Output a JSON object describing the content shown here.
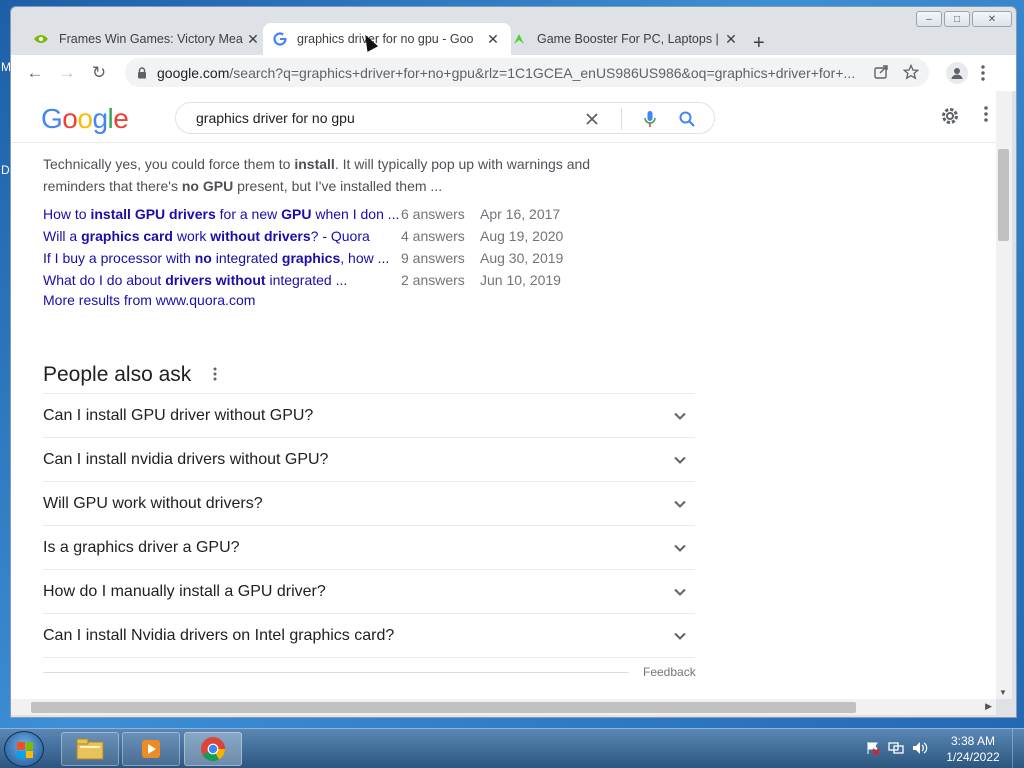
{
  "desktop": {
    "edge_letters": [
      "M",
      "D"
    ]
  },
  "window_controls": {
    "minimize": "‒",
    "maximize": "□",
    "close": "✕"
  },
  "tabs": [
    {
      "title": "Frames Win Games: Victory Mea",
      "favicon": "nvidia-favicon",
      "close": "✕"
    },
    {
      "title": "graphics driver for no gpu - Goo",
      "favicon": "google-favicon",
      "close": "✕"
    },
    {
      "title": "Game Booster For PC, Laptops | F",
      "favicon": "razer-favicon",
      "close": "✕"
    }
  ],
  "new_tab": "+",
  "toolbar": {
    "back": "←",
    "forward": "→",
    "reload": "↻",
    "url_host": "google.com",
    "url_rest": "/search?q=graphics+driver+for+no+gpu&rlz=1C1GCEA_enUS986US986&oq=graphics+driver+for+..."
  },
  "google": {
    "query": "graphics driver for no gpu",
    "logo_letters": [
      {
        "ch": "G",
        "color": "#4285f4"
      },
      {
        "ch": "o",
        "color": "#ea4335"
      },
      {
        "ch": "o",
        "color": "#fbbc05"
      },
      {
        "ch": "g",
        "color": "#4285f4"
      },
      {
        "ch": "l",
        "color": "#34a853"
      },
      {
        "ch": "e",
        "color": "#ea4335"
      }
    ]
  },
  "snippet": {
    "line1_a": "Technically yes, you could force them to ",
    "line1_b": "install",
    "line1_c": ". It will typically pop up with warnings and",
    "line2_a": "reminders that there's ",
    "line2_b": "no GPU",
    "line2_c": " present, but I've installed them ..."
  },
  "sub_results": [
    {
      "parts": [
        [
          "How to ",
          false
        ],
        [
          "install GPU drivers",
          true
        ],
        [
          " for a new ",
          false
        ],
        [
          "GPU",
          true
        ],
        [
          " when I don ...",
          false
        ]
      ],
      "answers": "6 answers",
      "date": "Apr 16, 2017"
    },
    {
      "parts": [
        [
          "Will a ",
          false
        ],
        [
          "graphics card",
          true
        ],
        [
          " work ",
          false
        ],
        [
          "without drivers",
          true
        ],
        [
          "? - Quora",
          false
        ]
      ],
      "answers": "4 answers",
      "date": "Aug 19, 2020"
    },
    {
      "parts": [
        [
          "If I buy a processor with ",
          false
        ],
        [
          "no",
          true
        ],
        [
          " integrated ",
          false
        ],
        [
          "graphics",
          true
        ],
        [
          ", how ...",
          false
        ]
      ],
      "answers": "9 answers",
      "date": "Aug 30, 2019"
    },
    {
      "parts": [
        [
          "What do I do about ",
          false
        ],
        [
          "drivers without",
          true
        ],
        [
          " integrated ...",
          false
        ]
      ],
      "answers": "2 answers",
      "date": "Jun 10, 2019"
    }
  ],
  "more_results": "More results from www.quora.com",
  "paa": {
    "title": "People also ask",
    "questions": [
      "Can I install GPU driver without GPU?",
      "Can I install nvidia drivers without GPU?",
      "Will GPU work without drivers?",
      "Is a graphics driver a GPU?",
      "How do I manually install a GPU driver?",
      "Can I install Nvidia drivers on Intel graphics card?"
    ]
  },
  "feedback": "Feedback",
  "taskbar": {
    "clock_time": "3:38 AM",
    "clock_date": "1/24/2022",
    "apps": [
      "file-explorer-icon",
      "media-player-icon",
      "chrome-icon"
    ]
  }
}
